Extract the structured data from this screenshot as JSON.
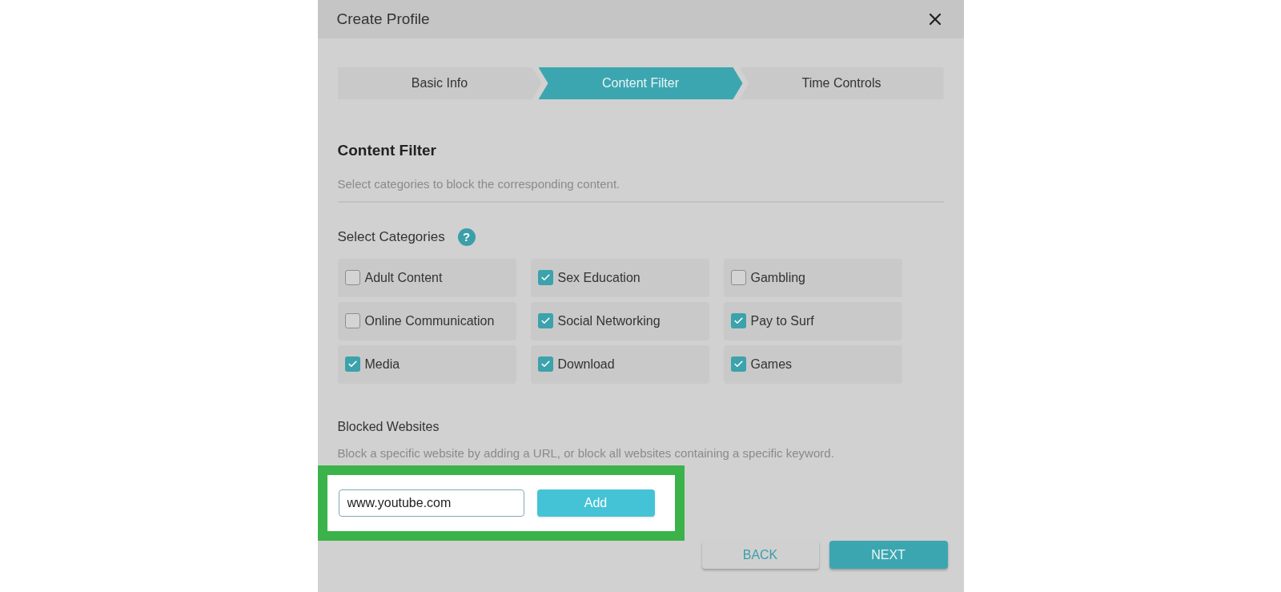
{
  "dialog": {
    "title": "Create Profile"
  },
  "steps": [
    {
      "label": "Basic Info",
      "selected": false
    },
    {
      "label": "Content Filter",
      "selected": true
    },
    {
      "label": "Time Controls",
      "selected": false
    }
  ],
  "section": {
    "title": "Content Filter",
    "description": "Select categories to block the corresponding content."
  },
  "categories": {
    "label": "Select Categories",
    "help": "?",
    "items": [
      {
        "label": "Adult Content",
        "checked": false
      },
      {
        "label": "Sex Education",
        "checked": true
      },
      {
        "label": "Gambling",
        "checked": false
      },
      {
        "label": "Online Communication",
        "checked": false
      },
      {
        "label": "Social Networking",
        "checked": true
      },
      {
        "label": "Pay to Surf",
        "checked": true
      },
      {
        "label": "Media",
        "checked": true
      },
      {
        "label": "Download",
        "checked": true
      },
      {
        "label": "Games",
        "checked": true
      }
    ]
  },
  "blocked_websites": {
    "title": "Blocked Websites",
    "description": "Block a specific website by adding a URL, or block all websites containing a specific keyword.",
    "url_value": "www.youtube.com",
    "add_button": "Add"
  },
  "buttons": {
    "back": "BACK",
    "next": "NEXT"
  }
}
